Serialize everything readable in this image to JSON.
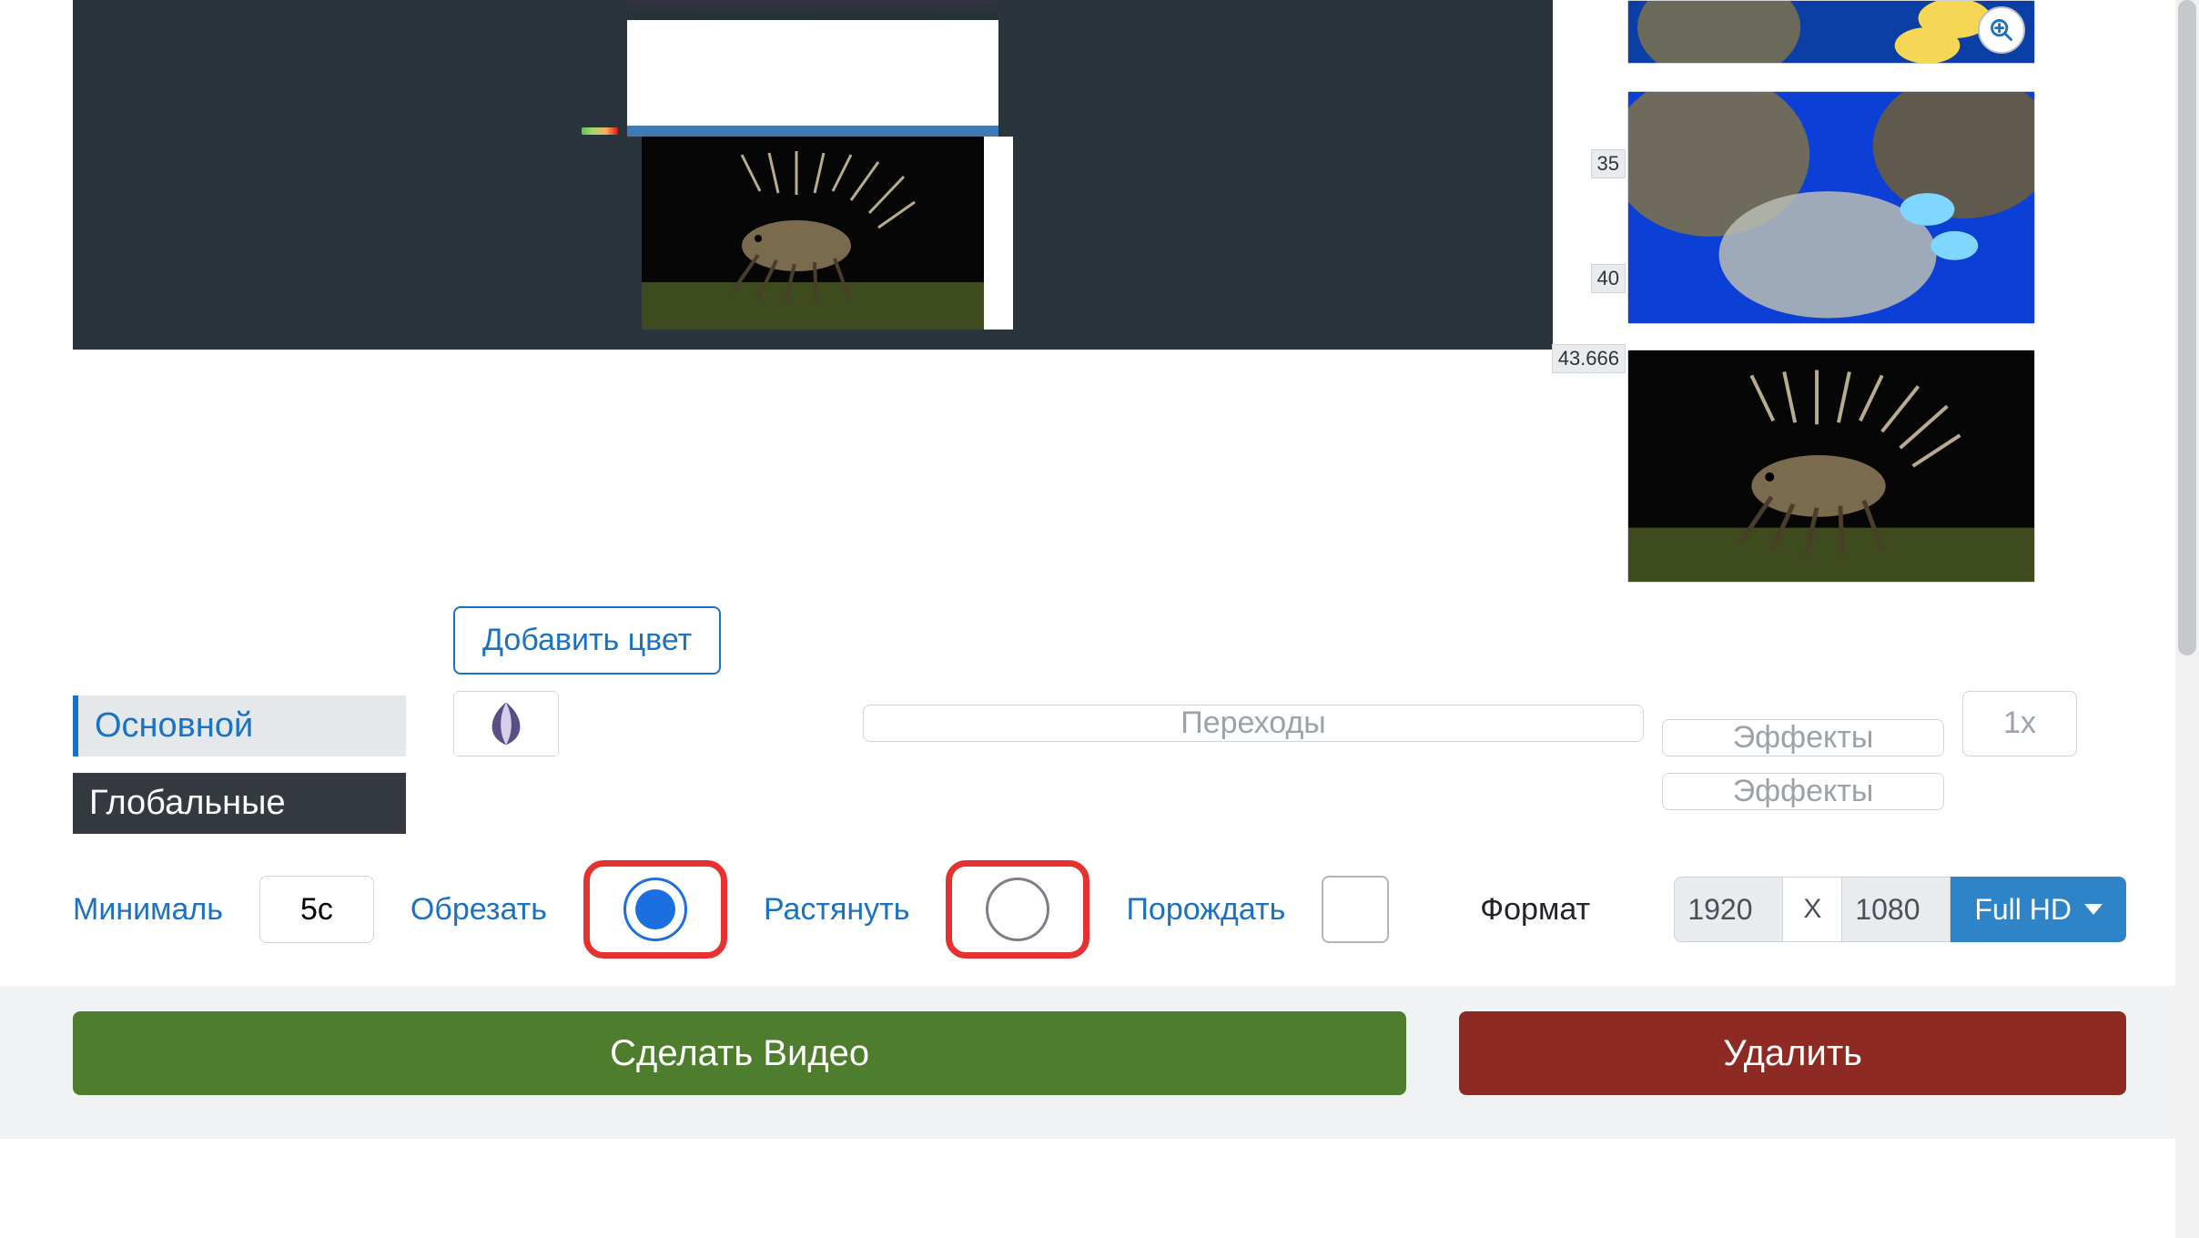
{
  "timeline": {
    "marks": [
      "35",
      "40",
      "43.666"
    ]
  },
  "controls": {
    "add_color": "Добавить цвет",
    "tab_main": "Основной",
    "tab_global": "Глобальные",
    "transitions_placeholder": "Переходы",
    "effects_placeholder": "Эффекты",
    "speed": "1x"
  },
  "options": {
    "min_label": "Минималь",
    "min_value": "5с",
    "crop_label": "Обрезать",
    "stretch_label": "Растянуть",
    "wait_label": "Порождать",
    "format_label": "Формат",
    "crop_selected": true,
    "stretch_selected": false
  },
  "format": {
    "width": "1920",
    "height": "1080",
    "separator": "X",
    "preset": "Full HD"
  },
  "actions": {
    "make_video": "Сделать Видео",
    "delete": "Удалить"
  },
  "icons": {
    "zoom": "zoom-in-icon"
  }
}
